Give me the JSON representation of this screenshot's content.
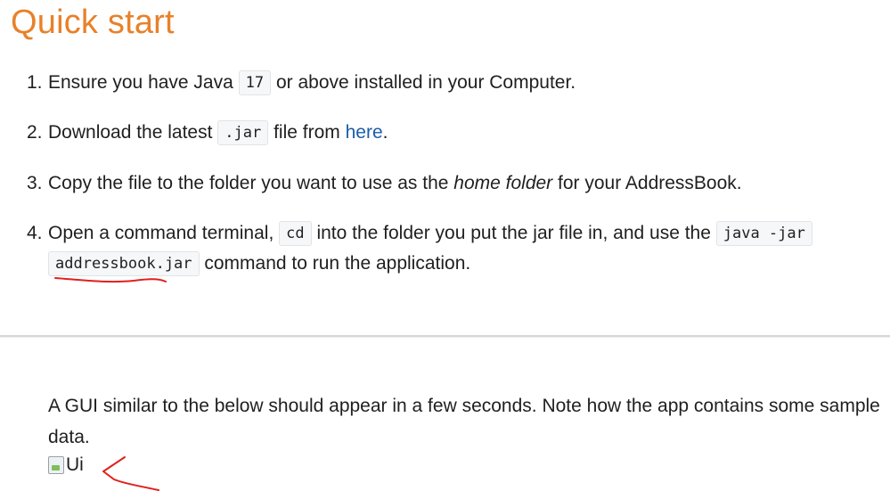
{
  "heading": "Quick start",
  "steps": [
    {
      "num": "1.",
      "pre": "Ensure you have Java ",
      "code": "17",
      "post": " or above installed in your Computer."
    },
    {
      "num": "2.",
      "pre": "Download the latest ",
      "code": ".jar",
      "mid": " file from ",
      "link": "here",
      "post": "."
    },
    {
      "num": "3.",
      "pre": "Copy the file to the folder you want to use as the ",
      "em": "home folder",
      "post": " for your AddressBook."
    },
    {
      "num": "4.",
      "pre": "Open a command terminal, ",
      "code1": "cd",
      "mid": " into the folder you put the jar file in, and use the ",
      "code2": "java -jar",
      "code3": "addressbook.jar",
      "post": " command to run the application."
    }
  ],
  "gui_paragraph": "A GUI similar to the below should appear in a few seconds. Note how the app contains some sample data.",
  "image_alt": "Ui",
  "colors": {
    "heading": "#e8812a",
    "link": "#1b5ea8",
    "annotation": "#e0201c"
  }
}
